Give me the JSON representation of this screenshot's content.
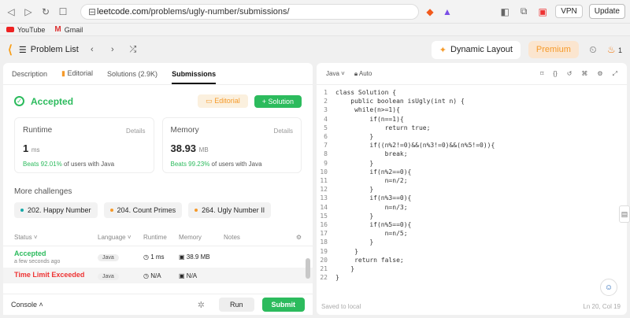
{
  "browser": {
    "url_host": "leetcode.com",
    "url_path": "/problems/ugly-number/submissions/",
    "vpn_label": "VPN",
    "update_label": "Update",
    "bookmarks": [
      {
        "label": "YouTube",
        "icon": "youtube-icon"
      },
      {
        "label": "Gmail",
        "icon": "gmail-icon"
      }
    ]
  },
  "header": {
    "problem_list": "Problem List",
    "dynamic_layout": "Dynamic Layout",
    "premium": "Premium",
    "streak": "1"
  },
  "left": {
    "tabs": [
      "Description",
      "Editorial",
      "Solutions (2.9K)",
      "Submissions"
    ],
    "status": "Accepted",
    "editorial_btn": "Editorial",
    "solution_btn": "+ Solution",
    "runtime": {
      "label": "Runtime",
      "details": "Details",
      "value": "1",
      "unit": "ms",
      "beats_pct": "Beats 92.01%",
      "beats_rest": "of users with Java"
    },
    "memory": {
      "label": "Memory",
      "details": "Details",
      "value": "38.93",
      "unit": "MB",
      "beats_pct": "Beats 99.23%",
      "beats_rest": "of users with Java"
    },
    "more_title": "More challenges",
    "challenges": [
      {
        "label": "202. Happy Number",
        "color": "#16a8a8"
      },
      {
        "label": "204. Count Primes",
        "color": "#f59a2a"
      },
      {
        "label": "264. Ugly Number II",
        "color": "#f59a2a"
      }
    ],
    "table_headers": [
      "Status",
      "Language",
      "Runtime",
      "Memory",
      "Notes"
    ],
    "rows": [
      {
        "status": "Accepted",
        "time": "a few seconds ago",
        "lang": "Java",
        "runtime": "1 ms",
        "memory": "38.9 MB"
      },
      {
        "status": "Time Limit Exceeded",
        "time": "",
        "lang": "Java",
        "runtime": "N/A",
        "memory": "N/A"
      }
    ],
    "console": "Console",
    "run": "Run",
    "submit": "Submit"
  },
  "editor": {
    "language": "Java",
    "mode": "Auto",
    "saved": "Saved to local",
    "position": "Ln 20, Col 19",
    "lines": [
      "class Solution {",
      "    public boolean isUgly(int n) {",
      "     while(n>=1){",
      "         if(n==1){",
      "             return true;",
      "         }",
      "         if((n%2!=0)&&(n%3!=0)&&(n%5!=0)){",
      "             break;",
      "         }",
      "         if(n%2==0){",
      "             n=n/2;",
      "         }",
      "         if(n%3==0){",
      "             n=n/3;",
      "         }",
      "         if(n%5==0){",
      "             n=n/5;",
      "         }",
      "     }",
      "     return false;",
      "    }",
      "}"
    ]
  }
}
